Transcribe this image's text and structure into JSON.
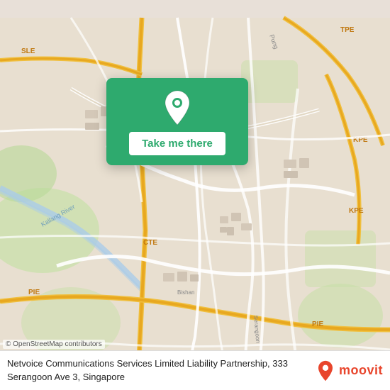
{
  "map": {
    "attribution": "© OpenStreetMap contributors"
  },
  "card": {
    "button_label": "Take me there"
  },
  "info": {
    "address": "Netvoice Communications Services Limited Liability Partnership, 333 Serangoon Ave 3, Singapore"
  },
  "moovit": {
    "label": "moovit"
  },
  "icons": {
    "pin": "location-pin-icon",
    "moovit_pin": "moovit-pin-icon"
  }
}
